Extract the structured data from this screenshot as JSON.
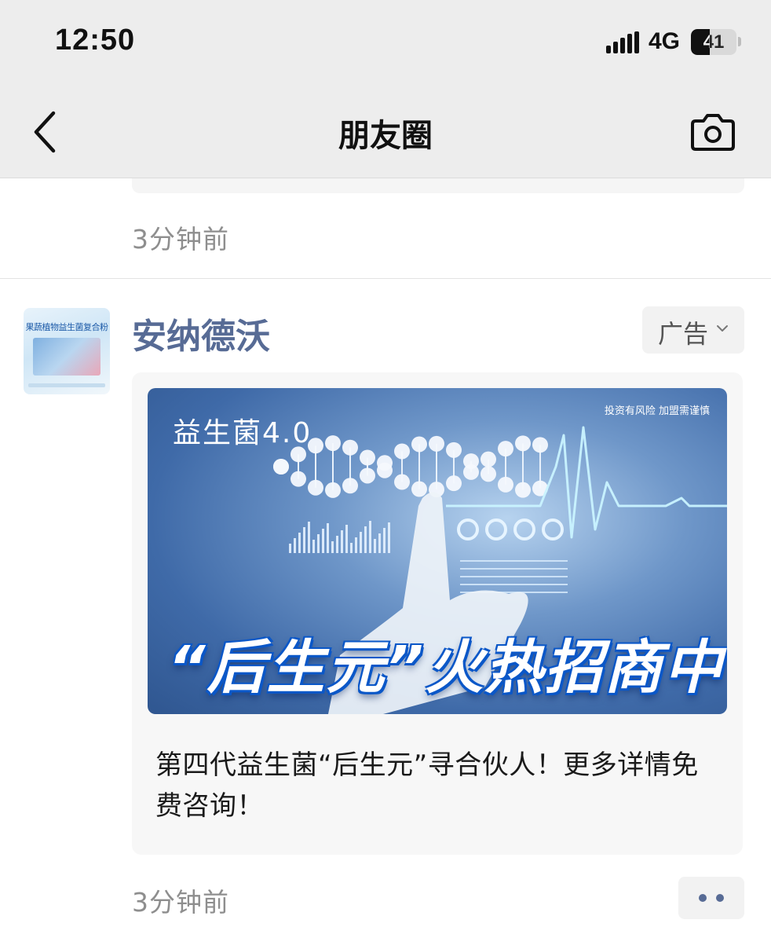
{
  "status_bar": {
    "time": "12:50",
    "network": "4G",
    "battery_level": "41",
    "battery_fraction": 0.41,
    "icons": [
      "signal-bars-icon",
      "battery-icon"
    ]
  },
  "nav": {
    "title": "朋友圈",
    "back_icon": "chevron-left-icon",
    "camera_icon": "camera-icon"
  },
  "previous_post": {
    "timestamp": "3分钟前"
  },
  "ad_post": {
    "author": "安纳德沃",
    "avatar": {
      "caption": "果蔬植物益生菌复合粉"
    },
    "ad_label": "广告",
    "banner": {
      "subtitle": "益生菌4.0",
      "warning": "投资有风险  加盟需谨慎",
      "headline": "“后生元”火热招商中"
    },
    "text": "第四代益生菌“后生元”寻合伙人！更多详情免费咨询！",
    "timestamp": "3分钟前",
    "more_icon": "more-dots-icon"
  },
  "colors": {
    "link_blue": "#576b95",
    "nav_bg": "#ededed",
    "card_bg": "#f7f7f7",
    "timestamp_gray": "#8e8e8e"
  }
}
